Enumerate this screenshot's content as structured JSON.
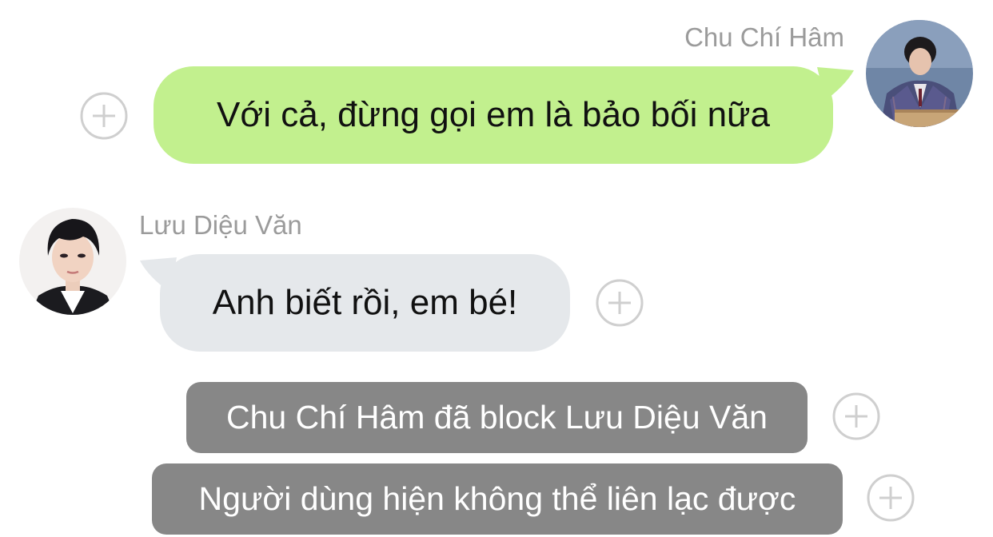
{
  "chat": {
    "messages": [
      {
        "sender": "Chu Chí Hâm",
        "direction": "outgoing",
        "text": "Với cả, đừng gọi em là bảo bối nữa",
        "bubble_color": "#c2f08e"
      },
      {
        "sender": "Lưu Diệu Văn",
        "direction": "incoming",
        "text": "Anh biết rồi, em bé!",
        "bubble_color": "#e5e8eb"
      }
    ],
    "system_notices": [
      {
        "text": "Chu Chí Hâm đã block Lưu Diệu Văn"
      },
      {
        "text": "Người dùng hiện không thể liên lạc được"
      }
    ]
  },
  "colors": {
    "outgoing_bubble": "#c2f08e",
    "incoming_bubble": "#e5e8eb",
    "system_pill": "#878787",
    "sender_name": "#9b9b9b",
    "plus_icon": "#cfcfcf"
  },
  "icons": {
    "plus": "plus-circle-icon",
    "avatar_right": "avatar-chu-chi-ham",
    "avatar_left": "avatar-luu-dieu-van"
  }
}
